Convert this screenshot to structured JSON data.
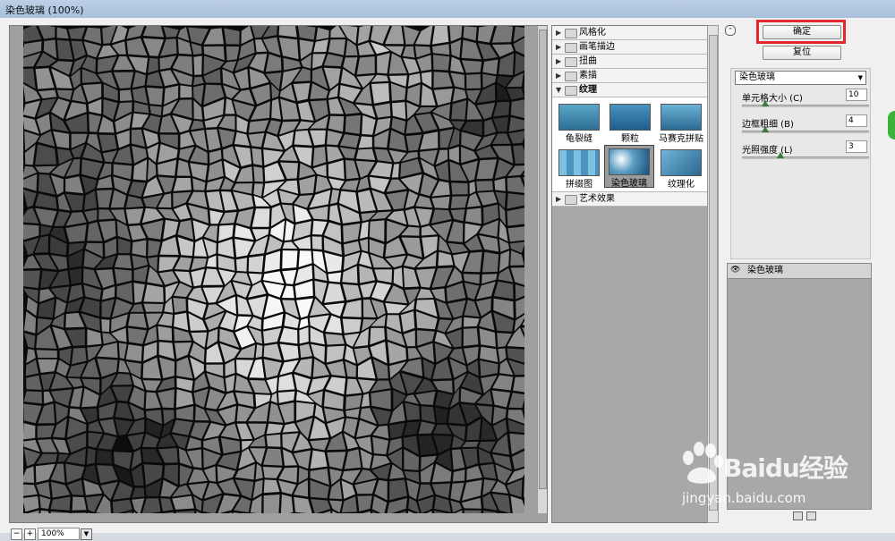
{
  "window": {
    "title": "染色玻璃 (100%)"
  },
  "preview": {
    "zoom": "100%",
    "zoom_out": "−",
    "zoom_in": "+"
  },
  "filter_categories": [
    {
      "label": "风格化",
      "expanded": false
    },
    {
      "label": "画笔描边",
      "expanded": false
    },
    {
      "label": "扭曲",
      "expanded": false
    },
    {
      "label": "素描",
      "expanded": false
    },
    {
      "label": "纹理",
      "expanded": true
    },
    {
      "label": "艺术效果",
      "expanded": false
    }
  ],
  "texture_filters": [
    {
      "label": "龟裂缝"
    },
    {
      "label": "颗粒"
    },
    {
      "label": "马赛克拼贴"
    },
    {
      "label": "拼缀图"
    },
    {
      "label": "染色玻璃",
      "selected": true
    },
    {
      "label": "纹理化"
    }
  ],
  "buttons": {
    "ok": "确定",
    "reset": "复位"
  },
  "settings": {
    "filter_select": "染色玻璃",
    "params": [
      {
        "label": "单元格大小 (C)",
        "value": "10",
        "level": 0.18
      },
      {
        "label": "边框粗细 (B)",
        "value": "4",
        "level": 0.18
      },
      {
        "label": "光照强度 (L)",
        "value": "3",
        "level": 0.3
      }
    ]
  },
  "layers": [
    {
      "name": "染色玻璃",
      "visible": true
    }
  ],
  "watermark": {
    "brand": "Baidu经验",
    "url": "jingyan.baidu.com"
  },
  "colors": {
    "highlight": "#e3282d",
    "badge": "#3bb33b"
  }
}
